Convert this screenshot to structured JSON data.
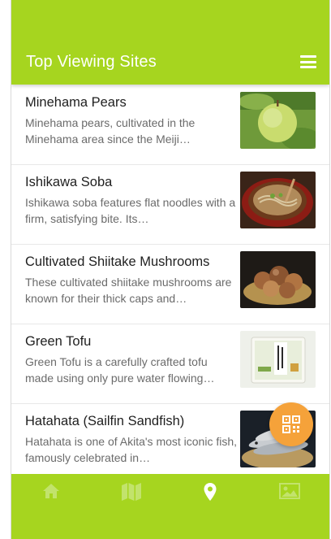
{
  "header": {
    "title": "Top Viewing Sites",
    "menu_icon": "hamburger-menu-icon"
  },
  "items": [
    {
      "title": "Minehama Pears",
      "description": "Minehama pears, cultivated in the Minehama area since the Meiji…",
      "image": "green-pear-photo"
    },
    {
      "title": "Ishikawa Soba",
      "description": "Ishikawa soba features flat noodles with a firm, satisfying bite. Its…",
      "image": "soba-bowl-photo"
    },
    {
      "title": "Cultivated Shiitake Mushrooms",
      "description": "These cultivated shiitake mushrooms are known for their thick caps and…",
      "image": "shiitake-basket-photo"
    },
    {
      "title": "Green Tofu",
      "description": "Green Tofu is a carefully crafted tofu made using only pure water flowing…",
      "image": "tofu-package-photo"
    },
    {
      "title": "Hatahata (Sailfin Sandfish)",
      "description": "Hatahata is one of Akita's most iconic fish, famously celebrated in…",
      "image": "hatahata-fish-photo"
    }
  ],
  "fab": {
    "icon": "qr-code-icon"
  },
  "bottom_nav": {
    "active": "location",
    "items": [
      {
        "icon": "home-icon",
        "id": "home"
      },
      {
        "icon": "map-icon",
        "id": "map"
      },
      {
        "icon": "location-pin-icon",
        "id": "location"
      },
      {
        "icon": "image-icon",
        "id": "gallery"
      }
    ]
  },
  "colors": {
    "brand_green": "#a6d51f",
    "fab_orange": "#f5a23a",
    "nav_inactive": "#bfe262",
    "nav_active": "#ffffff"
  }
}
